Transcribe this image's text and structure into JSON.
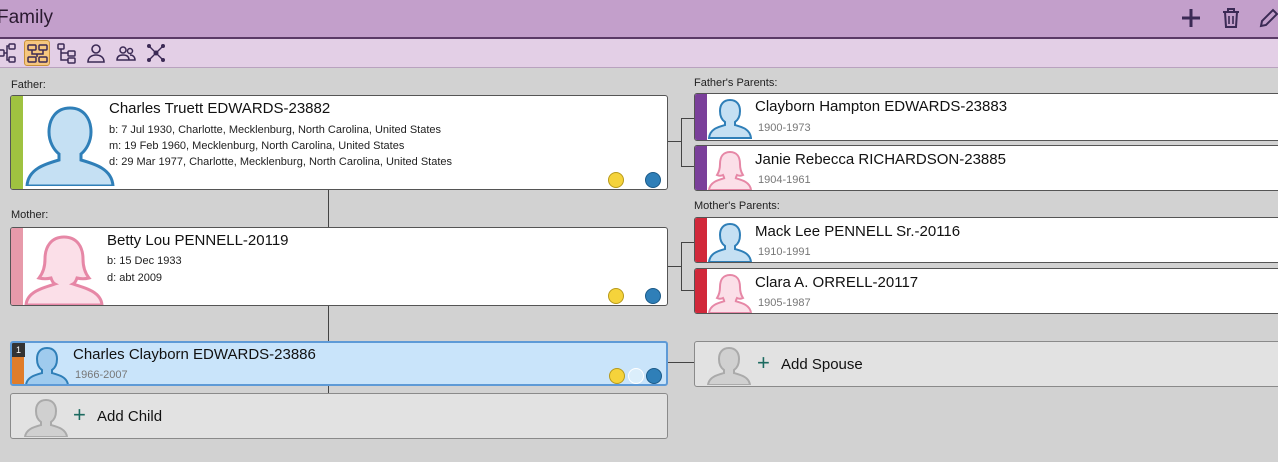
{
  "window": {
    "title": "Family"
  },
  "toolbar": {
    "actions": [
      {
        "name": "add-icon"
      },
      {
        "name": "trash-icon"
      },
      {
        "name": "edit-icon"
      }
    ],
    "views": [
      {
        "name": "pedigree-view-icon"
      },
      {
        "name": "family-view-icon",
        "active": true
      },
      {
        "name": "descendants-view-icon"
      },
      {
        "name": "individual-view-icon"
      },
      {
        "name": "group-view-icon"
      },
      {
        "name": "network-view-icon"
      }
    ]
  },
  "colors": {
    "male_bar": "#9fc240",
    "female_bar": "#e79aaa",
    "paternal_bar": "#7a3f9a",
    "maternal_bar": "#d1283a",
    "child_bar": "#e07d2b",
    "selected_bg": "#c9e4fa"
  },
  "father": {
    "section_label": "Father:",
    "name": "Charles Truett EDWARDS-23882",
    "birth": "b: 7 Jul 1930, Charlotte, Mecklenburg, North Carolina, United States",
    "marriage": "m: 19 Feb 1960, Mecklenburg, North Carolina, United States",
    "death": "d: 29 Mar 1977, Charlotte, Mecklenburg, North Carolina, United States"
  },
  "mother": {
    "section_label": "Mother:",
    "name": "Betty Lou PENNELL-20119",
    "birth": "b: 15 Dec 1933",
    "death": "d: abt 2009"
  },
  "fathers_parents": {
    "section_label": "Father's Parents:",
    "father": {
      "name": "Clayborn Hampton EDWARDS-23883",
      "dates": "1900-1973"
    },
    "mother": {
      "name": "Janie Rebecca RICHARDSON-23885",
      "dates": "1904-1961"
    }
  },
  "mothers_parents": {
    "section_label": "Mother's Parents:",
    "father": {
      "name": "Mack Lee PENNELL Sr.-20116",
      "dates": "1910-1991"
    },
    "mother": {
      "name": "Clara A. ORRELL-20117",
      "dates": "1905-1987"
    }
  },
  "child": {
    "index": "1",
    "name": "Charles Clayborn EDWARDS-23886",
    "dates": "1966-2007"
  },
  "add_spouse_label": "Add Spouse",
  "add_child_label": "Add Child",
  "plus_glyph": "+"
}
